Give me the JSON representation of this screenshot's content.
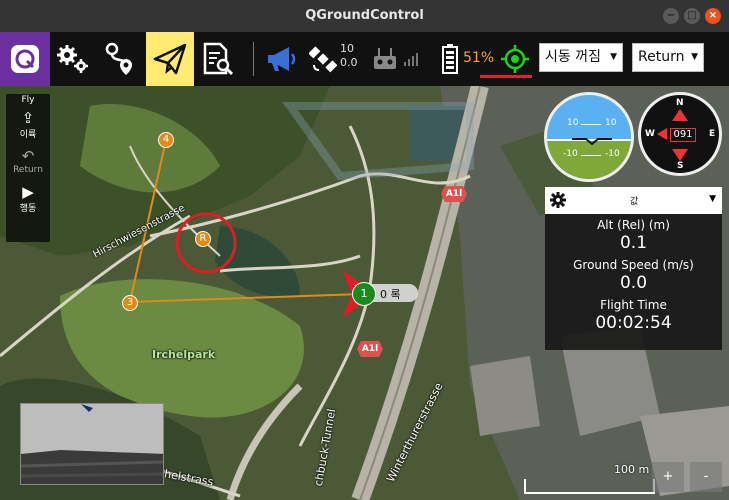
{
  "window": {
    "title": "QGroundControl",
    "buttons": [
      "−",
      "□",
      "×"
    ]
  },
  "toolbar": {
    "gps_count": "10",
    "gps_hdop": "0.0",
    "battery": "51%",
    "arm_state": "시동 꺼짐",
    "flight_mode": "Return",
    "mode_indicator_color": "#19d619",
    "alert_color": "#e0202a",
    "active_view_color": "#ffeb74",
    "brand_color": "#6b2fa0"
  },
  "fly_strip": {
    "header": "Fly",
    "items": [
      {
        "label": "이륙",
        "icon": "takeoff-icon"
      },
      {
        "label": "Return",
        "icon": "return-icon"
      },
      {
        "label": "행동",
        "icon": "action-play-icon"
      }
    ]
  },
  "map": {
    "labels": {
      "street1": "Hirschwiesenstrasse",
      "park": "Irchelpark",
      "street2": "Winterthurerstrasse",
      "tunnel": "chbuck-Tunnel",
      "street3": "chelstrass",
      "road_sign": "A1l"
    },
    "waypoints": [
      {
        "label": "4"
      },
      {
        "label": "3"
      },
      {
        "label": "R"
      }
    ],
    "vehicle": {
      "id": "1",
      "label": "0 록"
    },
    "scale": "100 m",
    "zoom_in": "+",
    "zoom_out": "-"
  },
  "instruments": {
    "pitch_marks": [
      "10",
      "10",
      "-10",
      "-10"
    ],
    "compass": {
      "n": "N",
      "s": "S",
      "e": "E",
      "w": "W",
      "heading": "091"
    }
  },
  "values_panel": {
    "selector": "값",
    "items": [
      {
        "label": "Alt (Rel) (m)",
        "value": "0.1"
      },
      {
        "label": "Ground Speed (m/s)",
        "value": "0.0"
      },
      {
        "label": "Flight Time",
        "value": "00:02:54"
      }
    ]
  }
}
